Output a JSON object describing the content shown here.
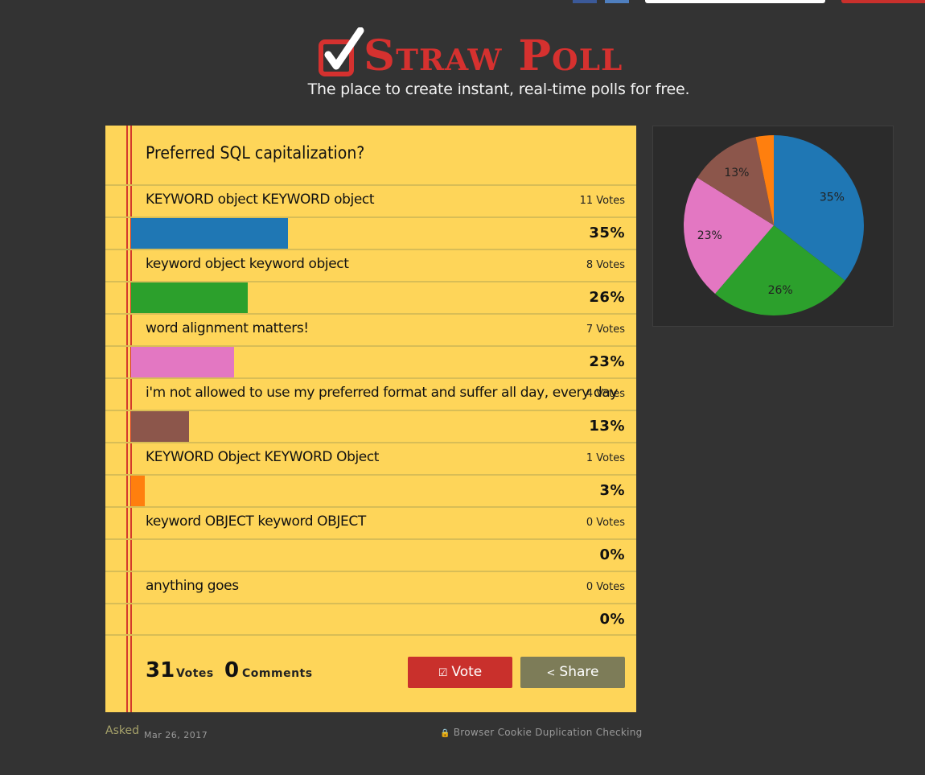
{
  "brand": {
    "name": "Straw Poll",
    "tagline": "The place to create instant, real-time polls for free."
  },
  "poll": {
    "question": "Preferred SQL capitalization?",
    "options": [
      {
        "label": "KEYWORD object KEYWORD object",
        "votes_text": "11 Votes",
        "percent_text": "35%",
        "percent": 35,
        "color": "#1f77b4"
      },
      {
        "label": "keyword object keyword object",
        "votes_text": "8 Votes",
        "percent_text": "26%",
        "percent": 26,
        "color": "#2ca02c"
      },
      {
        "label": "word alignment matters!",
        "votes_text": "7 Votes",
        "percent_text": "23%",
        "percent": 23,
        "color": "#e377c2"
      },
      {
        "label": "i'm not allowed to use my preferred format and suffer all day, every day",
        "votes_text": "4 Votes",
        "percent_text": "13%",
        "percent": 13,
        "color": "#8c564b"
      },
      {
        "label": "KEYWORD Object KEYWORD Object",
        "votes_text": "1 Votes",
        "percent_text": "3%",
        "percent": 3,
        "color": "#ff7f0e"
      },
      {
        "label": "keyword OBJECT keyword OBJECT",
        "votes_text": "0 Votes",
        "percent_text": "0%",
        "percent": 0,
        "color": "#9467bd"
      },
      {
        "label": "anything goes",
        "votes_text": "0 Votes",
        "percent_text": "0%",
        "percent": 0,
        "color": "#7f7f7f"
      }
    ],
    "total_votes": "31",
    "votes_word": "Votes",
    "comments": "0",
    "comments_word": "Comments",
    "vote_button": "Vote",
    "share_button": "Share",
    "asked_label": "Asked",
    "date": "Mar 26, 2017",
    "dupe_check": "Browser Cookie Duplication Checking"
  },
  "chart_data": {
    "type": "pie",
    "labels": [
      "KEYWORD object KEYWORD object",
      "keyword object keyword object",
      "word alignment matters!",
      "i'm not allowed to use my preferred format and suffer all day, every day",
      "KEYWORD Object KEYWORD Object"
    ],
    "values": [
      11,
      8,
      7,
      4,
      1
    ],
    "slice_labels": [
      "35%",
      "26%",
      "23%",
      "13%",
      ""
    ],
    "colors": [
      "#1f77b4",
      "#2ca02c",
      "#e377c2",
      "#8c564b",
      "#ff7f0e"
    ]
  }
}
